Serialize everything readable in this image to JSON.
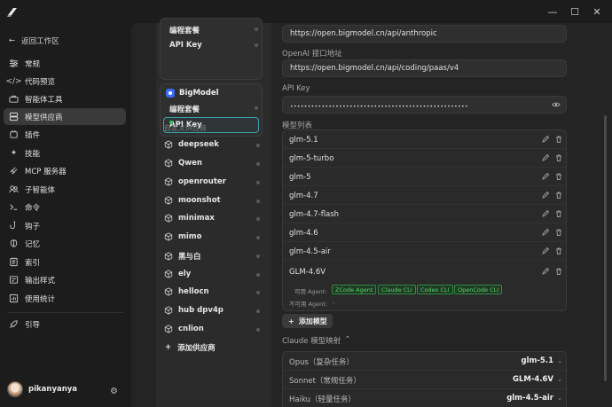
{
  "window": {
    "minimize": "—",
    "maximize": "☐",
    "close": "✕"
  },
  "sidebar": {
    "back_label": "返回工作区",
    "items": [
      {
        "label": "常规",
        "icon": "sliders-icon"
      },
      {
        "label": "代码预览",
        "icon": "code-icon"
      },
      {
        "label": "智能体工具",
        "icon": "toolbox-icon"
      },
      {
        "label": "模型供应商",
        "icon": "server-icon",
        "active": true
      },
      {
        "label": "插件",
        "icon": "plugin-icon"
      },
      {
        "label": "技能",
        "icon": "sparkle-icon"
      },
      {
        "label": "MCP 服务器",
        "icon": "mcp-icon"
      },
      {
        "label": "子智能体",
        "icon": "users-icon"
      },
      {
        "label": "命令",
        "icon": "terminal-icon"
      },
      {
        "label": "钩子",
        "icon": "hook-icon"
      },
      {
        "label": "记忆",
        "icon": "brain-icon"
      },
      {
        "label": "索引",
        "icon": "index-icon"
      },
      {
        "label": "输出样式",
        "icon": "output-icon"
      },
      {
        "label": "使用统计",
        "icon": "chart-icon"
      }
    ],
    "guide_label": "引导",
    "user_name": "pikanyanya"
  },
  "providers": {
    "card1": {
      "items": [
        {
          "label": "编程套餐"
        },
        {
          "label": "API Key"
        }
      ]
    },
    "bigmodel": {
      "title": "BigModel",
      "items": [
        {
          "label": "编程套餐"
        },
        {
          "label": "API Key",
          "active": true
        }
      ]
    },
    "custom_title": "自定义供应商",
    "custom": [
      {
        "label": "deepseek"
      },
      {
        "label": "Qwen"
      },
      {
        "label": "openrouter"
      },
      {
        "label": "moonshot"
      },
      {
        "label": "minimax"
      },
      {
        "label": "mimo"
      },
      {
        "label": "黑与白"
      },
      {
        "label": "ely"
      },
      {
        "label": "hellocn"
      },
      {
        "label": "hub dpv4p"
      },
      {
        "label": "cnlion"
      }
    ],
    "add_label": "添加供应商"
  },
  "detail": {
    "anthropic_url": "https://open.bigmodel.cn/api/anthropic",
    "openai_label": "OpenAI 接口地址",
    "openai_url": "https://open.bigmodel.cn/api/coding/paas/v4",
    "apikey_label": "API Key",
    "apikey_mask": "•••••••••••••••••••••••••••••••••••••••••••••••••••",
    "models_label": "模型列表",
    "models": [
      {
        "name": "glm-5.1"
      },
      {
        "name": "glm-5-turbo"
      },
      {
        "name": "glm-5"
      },
      {
        "name": "glm-4.7"
      },
      {
        "name": "glm-4.7-flash"
      },
      {
        "name": "glm-4.6"
      },
      {
        "name": "glm-4.5-air"
      }
    ],
    "special_model": {
      "name": "GLM-4.6V",
      "available_label": "可用 Agent:",
      "agents": [
        "ZCode Agent",
        "Claude CLI",
        "Codex CLI",
        "OpenCode CLI"
      ],
      "unavailable_label": "不可用 Agent:",
      "unavailable_value": "-"
    },
    "add_model_label": "添加模型",
    "mapping_title": "Claude 模型映射",
    "mapping": [
      {
        "key": "Opus（复杂任务）",
        "value": "glm-5.1"
      },
      {
        "key": "Sonnet（常规任务）",
        "value": "GLM-4.6V"
      },
      {
        "key": "Haiku（轻量任务）",
        "value": "glm-4.5-air"
      }
    ]
  },
  "colors": {
    "accent_green": "#43c35a",
    "active_border": "#3aa1a8",
    "background": "#1c1c1c"
  }
}
